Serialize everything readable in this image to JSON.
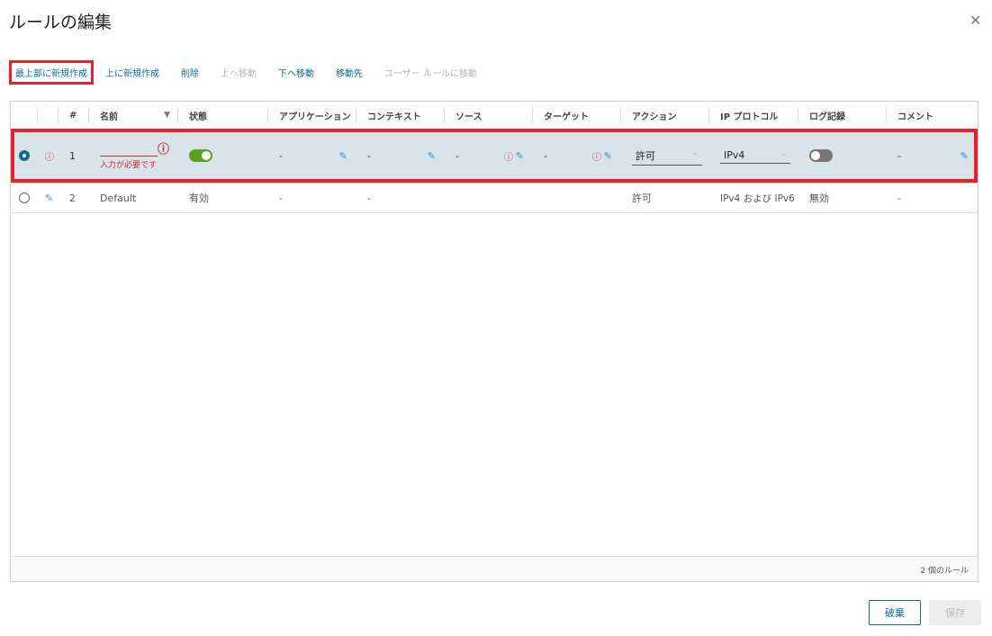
{
  "title": "ルールの編集",
  "toolbar": [
    "最上部に新規作成",
    "上に新規作成",
    "削除",
    "上へ移動",
    "下へ移動",
    "移動先",
    "ユーザー ルールに移動"
  ],
  "columns": [
    "#",
    "名前",
    "状態",
    "アプリケーション",
    "コンテキスト",
    "ソース",
    "ターゲット",
    "アクション",
    "IP プロトコル",
    "ログ記録",
    "コメント"
  ],
  "row1": {
    "num": "1",
    "name_error": "入力が必要です",
    "app": "-",
    "context": "-",
    "source": "-",
    "target": "-",
    "action": "許可",
    "ip": "IPv4",
    "comment": "-",
    "state_enabled": true,
    "log_enabled": false
  },
  "row2": {
    "num": "2",
    "name": "Default",
    "state": "有効",
    "app": "-",
    "context": "-",
    "action": "許可",
    "ip": "IPv4 および IPv6",
    "log": "無効",
    "comment": "-"
  },
  "footer": "2 個のルール",
  "buttons": {
    "discard": "破棄",
    "save": "保存"
  },
  "colors": {
    "accent": "#0f6b9c",
    "error": "#c9302c",
    "highlight": "#e8202a"
  }
}
